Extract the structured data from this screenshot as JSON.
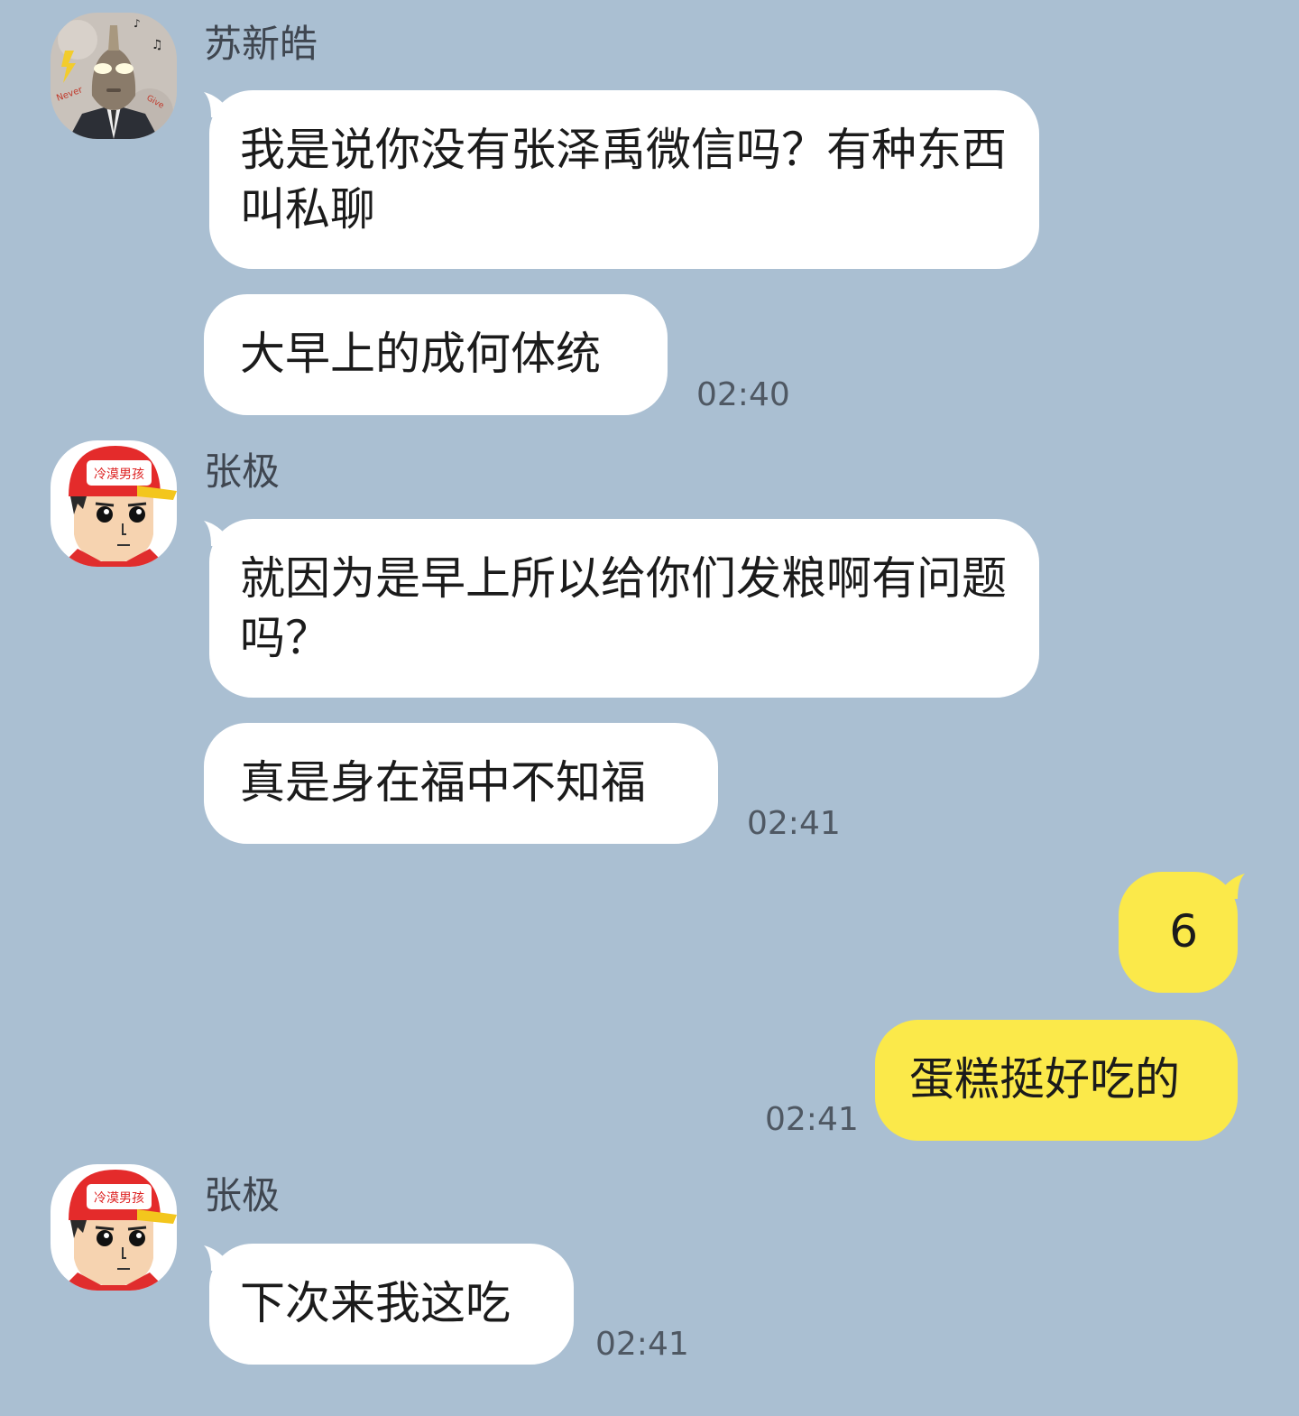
{
  "chat": {
    "groups": [
      {
        "sender": "苏新皓",
        "avatar": "ultraman-avatar",
        "messages": [
          "我是说你没有张泽禹微信吗？有种东西叫私聊",
          "大早上的成何体统"
        ],
        "time": "02:40"
      },
      {
        "sender": "张极",
        "avatar": "cap-boy-avatar",
        "avatar_cap_text": "冷漠男孩",
        "messages": [
          "就因为是早上所以给你们发粮啊有问题吗？",
          "真是身在福中不知福"
        ],
        "time": "02:41"
      },
      {
        "sender": "self",
        "messages": [
          "6",
          "蛋糕挺好吃的"
        ],
        "time": "02:41"
      },
      {
        "sender": "张极",
        "avatar": "cap-boy-avatar",
        "avatar_cap_text": "冷漠男孩",
        "messages": [
          "下次来我这吃"
        ],
        "time": "02:41"
      }
    ]
  },
  "colors": {
    "background": "#aabfd2",
    "incoming_bubble": "#ffffff",
    "outgoing_bubble": "#fbe94a"
  }
}
